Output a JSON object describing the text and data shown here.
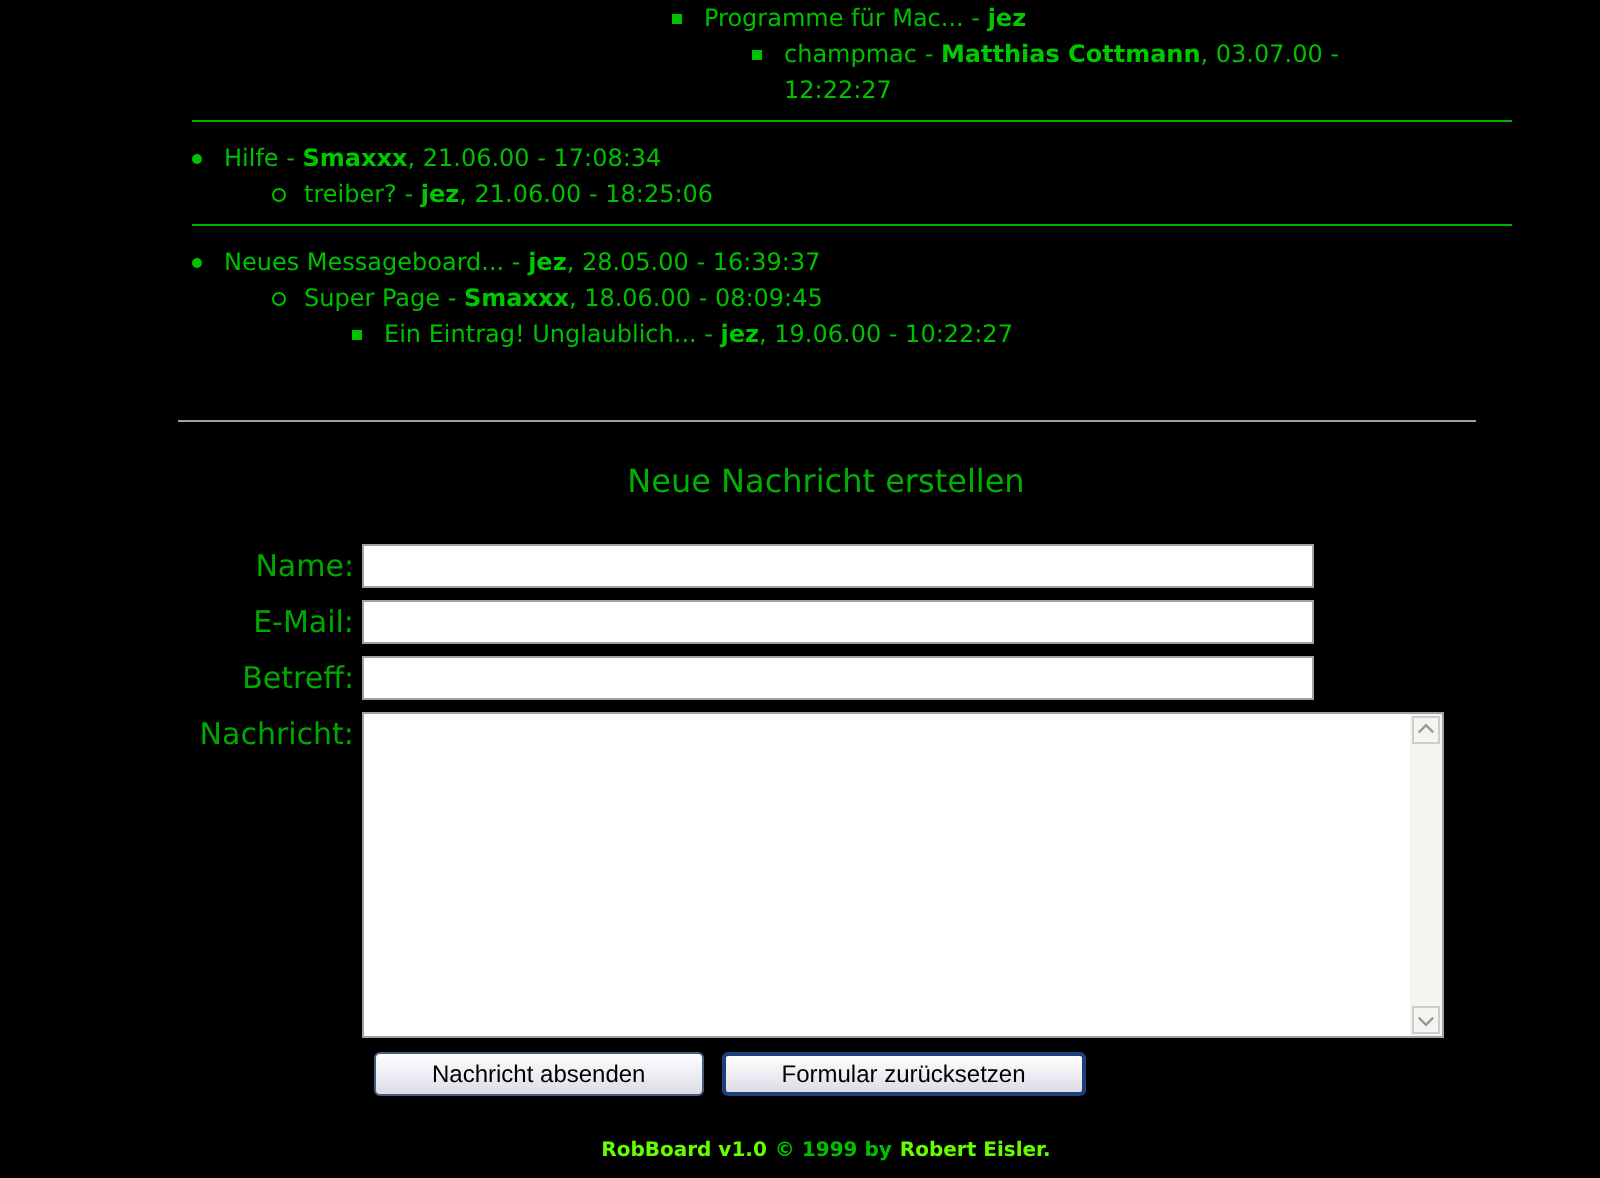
{
  "threads": [
    {
      "kind": "continued",
      "posts": [
        {
          "text": "Programme für Mac... - **jez**",
          "children": [
            {
              "text": "champmac - **Matthias Cottmann**, 03.07.00 - 12:22:27"
            }
          ]
        }
      ]
    },
    {
      "kind": "full",
      "posts": [
        {
          "text": "Hilfe - **Smaxxx**, 21.06.00 - 17:08:34",
          "children": [
            {
              "text": "treiber? - **jez**, 21.06.00 - 18:25:06"
            }
          ]
        }
      ]
    },
    {
      "kind": "full",
      "posts": [
        {
          "text": "Neues Messageboard... - **jez**, 28.05.00 - 16:39:37",
          "children": [
            {
              "text": "Super Page - **Smaxxx**, 18.06.00 - 08:09:45",
              "children": [
                {
                  "text": "Ein Eintrag! Unglaublich... - **jez**, 19.06.00 - 10:22:27"
                }
              ]
            }
          ]
        }
      ]
    }
  ],
  "form": {
    "heading": "Neue Nachricht erstellen",
    "fields": [
      {
        "kind": "input",
        "label": "Name:"
      },
      {
        "kind": "input",
        "label": "E-Mail:"
      },
      {
        "kind": "input",
        "label": "Betreff:"
      },
      {
        "kind": "textarea",
        "label": "Nachricht:"
      }
    ],
    "buttons": [
      {
        "label": "Nachricht absenden",
        "focused": false
      },
      {
        "label": "Formular zurücksetzen",
        "focused": true
      }
    ]
  },
  "footer": [
    {
      "text": "RobBoard v1.0",
      "bright": true
    },
    {
      "text": "© 1999 by",
      "bright": false
    },
    {
      "text": "Robert Eisler.",
      "bright": true
    }
  ]
}
